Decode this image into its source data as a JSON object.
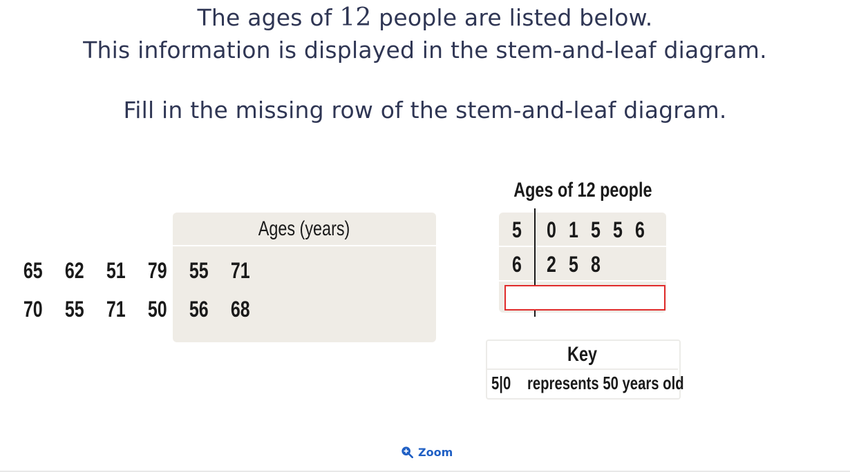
{
  "question": {
    "line1_pre": "The ages of ",
    "line1_num": "12",
    "line1_post": " people are listed below.",
    "line2": "This information is displayed in the stem-and-leaf diagram.",
    "line3": "Fill in the missing row of the stem-and-leaf diagram."
  },
  "ages_table": {
    "header": "Ages (years)",
    "rows": [
      [
        "65",
        "62",
        "51",
        "79",
        "55",
        "71"
      ],
      [
        "70",
        "55",
        "71",
        "50",
        "56",
        "68"
      ]
    ]
  },
  "stem_leaf": {
    "title": "Ages of 12 people",
    "rows": [
      {
        "stem": "5",
        "leaves": [
          "0",
          "1",
          "5",
          "5",
          "6"
        ]
      },
      {
        "stem": "6",
        "leaves": [
          "2",
          "5",
          "8"
        ]
      }
    ],
    "answer_value": ""
  },
  "key": {
    "title": "Key",
    "example": "5|0",
    "description": "represents 50 years old"
  },
  "zoom": {
    "label": "Zoom",
    "icon": "zoom-in-icon",
    "color": "#1f5fc4"
  },
  "colors": {
    "table_bg": "#efece6",
    "input_border": "#e02b2b"
  }
}
